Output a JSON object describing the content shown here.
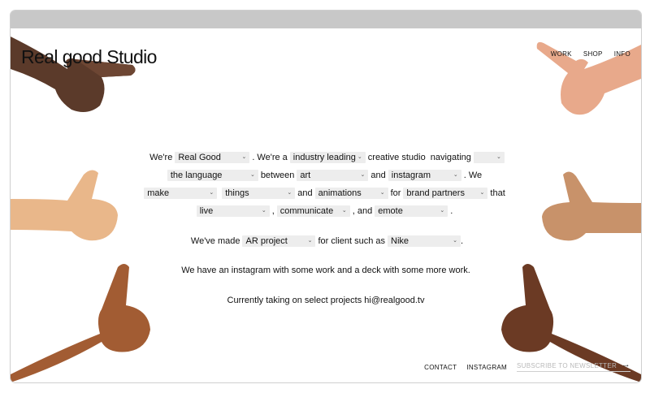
{
  "brand": {
    "logo_text": "Real good Studio"
  },
  "nav": {
    "items": [
      "WORK",
      "SHOP",
      "INFO"
    ]
  },
  "intro": {
    "w1": "We're",
    "s1": "Real Good",
    "t1": ". We're a",
    "s2": "industry leading",
    "s3": "creative studio",
    "w2": "navigating",
    "s4": "",
    "s5": "the language",
    "w3": "between",
    "s6": "art",
    "w4": "and",
    "s7": "instagram",
    "w5": ". We",
    "s8": "make",
    "s9": "things",
    "w6": "and",
    "s10": "animations",
    "w7": "for",
    "s11": "brand partners",
    "w8": "that",
    "s12": "live",
    "w9": ",",
    "s13": "communicate",
    "w10": ", and",
    "s14": "emote",
    "w11": "."
  },
  "made": {
    "prefix": "We've made",
    "project": "AR project",
    "middle": "for client such as",
    "client": "Nike",
    "suffix": "."
  },
  "instagram_line": "We have an instagram with some work and a deck with some more work.",
  "contact_line": "Currently taking on select projects hi@realgood.tv",
  "footer": {
    "contact": "CONTACT",
    "instagram": "INSTAGRAM",
    "subscribe_placeholder": "SUBSCRIBE TO NEWSLETTER",
    "arrow": "→"
  },
  "icons": {
    "chevron": "chevron-down-icon"
  },
  "colors": {
    "select_bg": "#ededed",
    "topbar": "#c8c8c8"
  }
}
